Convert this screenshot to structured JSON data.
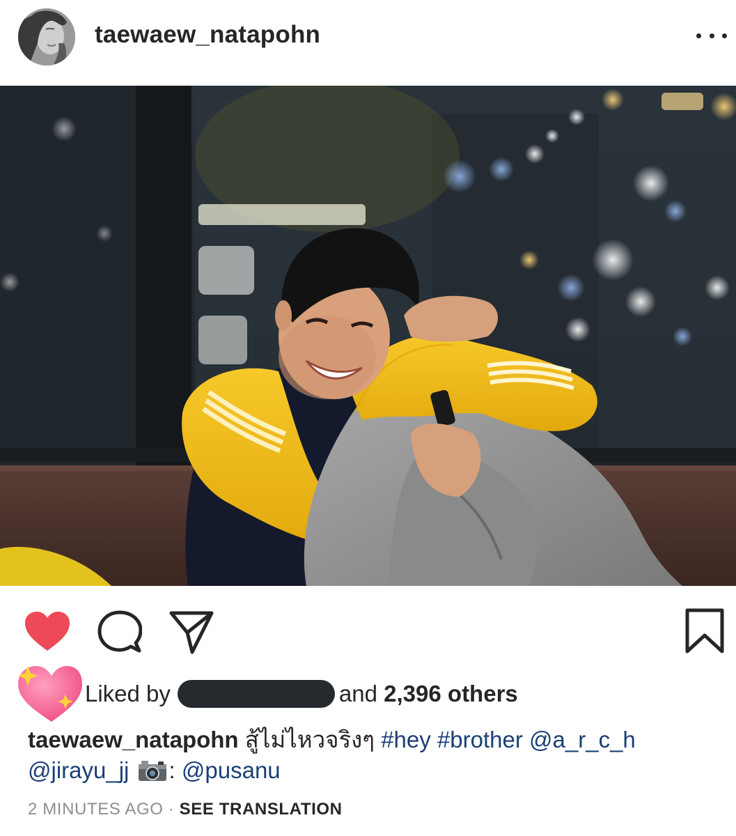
{
  "post": {
    "username": "taewaew_natapohn",
    "photo_alt": "Photo post",
    "likes": {
      "prefix": "Liked by",
      "connector": "and",
      "count_text": "2,396 others"
    },
    "caption": {
      "username": "taewaew_natapohn",
      "text": "สู้ไม่ไหวจริงๆ",
      "hashtag_1": "#hey",
      "hashtag_2": "#brother",
      "mention_1": "@a_r_c_h",
      "mention_2": "@jirayu_jj",
      "camera_suffix": ":",
      "mention_3": "@pusanu"
    },
    "timestamp": "2 MINUTES AGO",
    "separator": "·",
    "see_translation": "SEE TRANSLATION"
  },
  "icons": {
    "more": "more-options-icon",
    "like": "heart-filled-icon",
    "comment": "comment-bubble-icon",
    "share": "paper-plane-icon",
    "save": "bookmark-icon",
    "sticker": "sparkling-heart-icon",
    "camera": "camera-emoji-icon"
  },
  "colors": {
    "heart": "#ed4956",
    "link": "#1b3f75",
    "text": "#262626",
    "muted": "#8e8e8e",
    "sweater": "#f3c01a"
  }
}
